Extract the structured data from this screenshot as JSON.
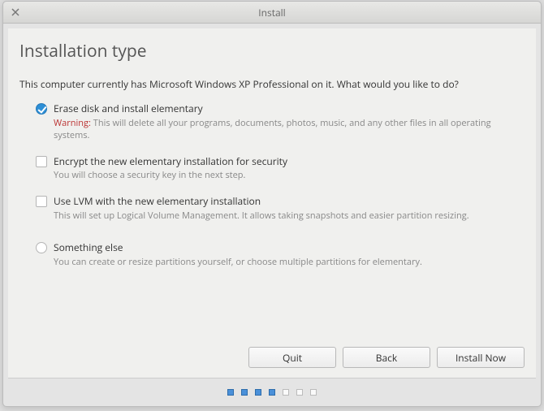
{
  "window": {
    "title": "Install"
  },
  "page": {
    "title": "Installation type"
  },
  "intro": "This computer currently has Microsoft Windows XP Professional on it. What would you like to do?",
  "options": {
    "erase": {
      "label": "Erase disk and install elementary",
      "warning_prefix": "Warning:",
      "warning_text": " This will delete all your programs, documents, photos, music, and any other files in all operating systems.",
      "selected": true
    },
    "encrypt": {
      "label": "Encrypt the new elementary installation for security",
      "desc": "You will choose a security key in the next step.",
      "checked": false
    },
    "lvm": {
      "label": "Use LVM with the new elementary installation",
      "desc": "This will set up Logical Volume Management. It allows taking snapshots and easier partition resizing.",
      "checked": false
    },
    "something_else": {
      "label": "Something else",
      "desc": "You can create or resize partitions yourself, or choose multiple partitions for elementary.",
      "selected": false
    }
  },
  "buttons": {
    "quit": "Quit",
    "back": "Back",
    "install_now": "Install Now"
  },
  "steps": {
    "total": 7,
    "completed": 4
  }
}
